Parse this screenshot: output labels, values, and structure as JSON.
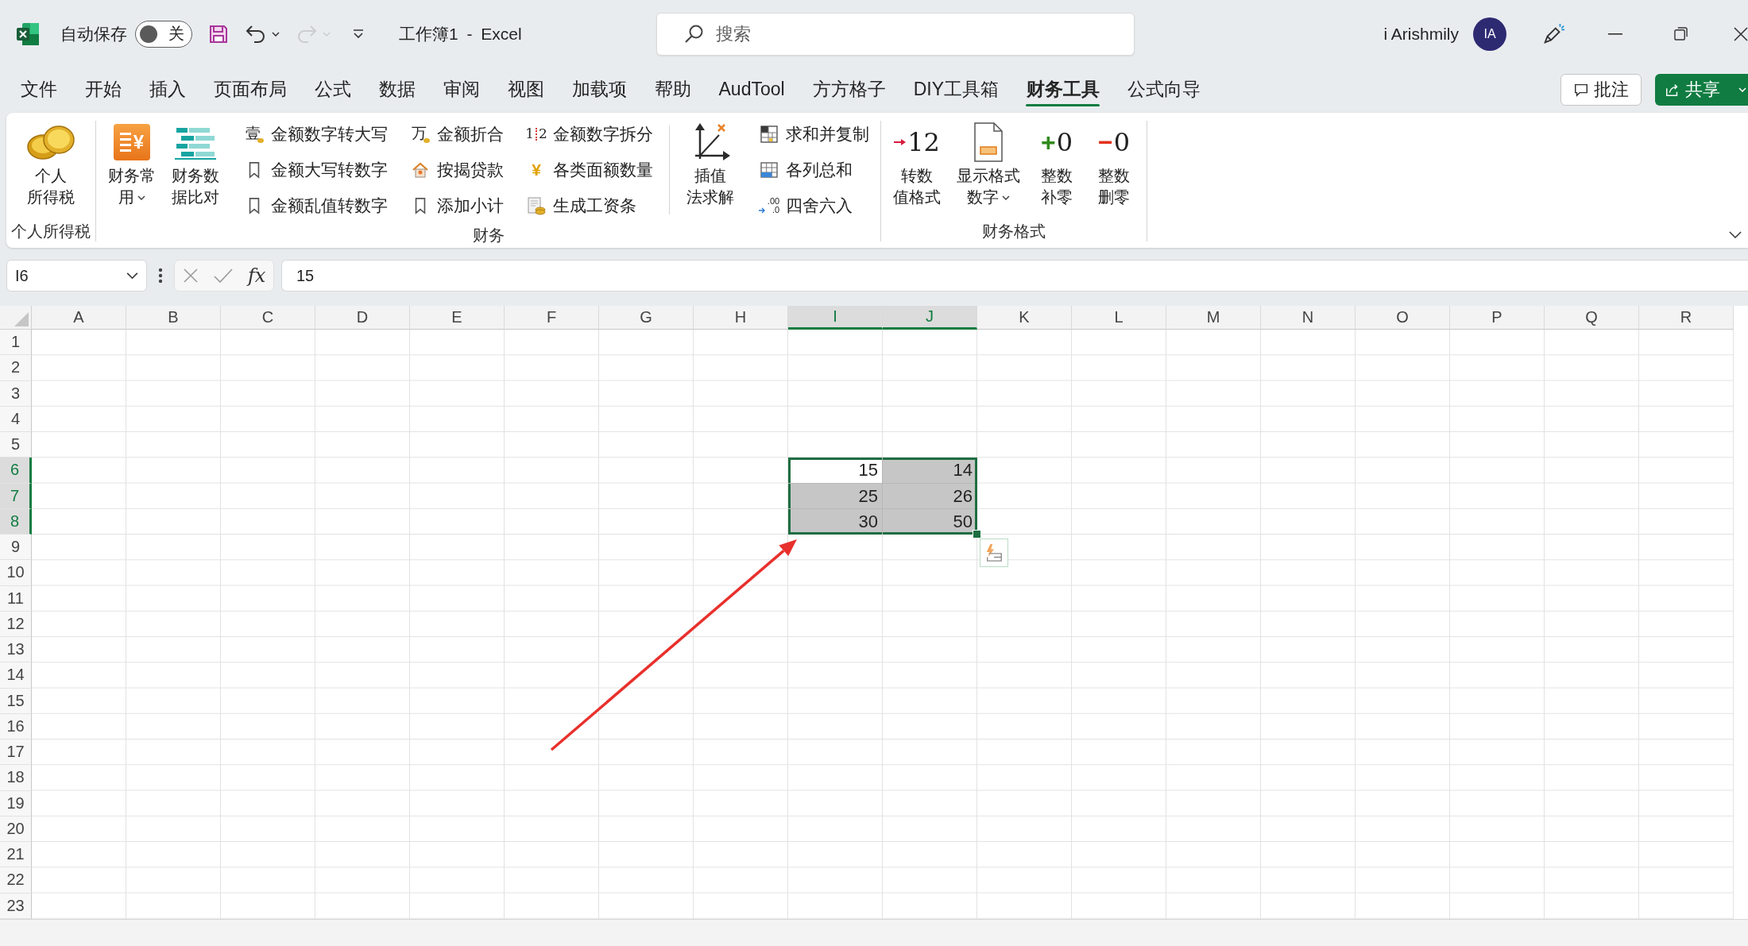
{
  "title_bar": {
    "autosave": {
      "label": "自动保存",
      "on": false,
      "state_text": "关"
    },
    "quick_access": [
      {
        "kind": "save",
        "disabled": false
      },
      {
        "kind": "undo",
        "disabled": false
      },
      {
        "kind": "redo",
        "disabled": true
      },
      {
        "kind": "customize",
        "disabled": false
      }
    ],
    "document_title": "工作簿1 - Excel",
    "search": {
      "placeholder": "搜索"
    },
    "user": {
      "name": "i Arishmily",
      "initials": "IA"
    }
  },
  "menu_tabs": [
    {
      "label": "文件",
      "selected": false
    },
    {
      "label": "开始",
      "selected": false
    },
    {
      "label": "插入",
      "selected": false
    },
    {
      "label": "页面布局",
      "selected": false
    },
    {
      "label": "公式",
      "selected": false
    },
    {
      "label": "数据",
      "selected": false
    },
    {
      "label": "审阅",
      "selected": false
    },
    {
      "label": "视图",
      "selected": false
    },
    {
      "label": "加载项",
      "selected": false
    },
    {
      "label": "帮助",
      "selected": false
    },
    {
      "label": "AudTool",
      "selected": false
    },
    {
      "label": "方方格子",
      "selected": false
    },
    {
      "label": "DIY工具箱",
      "selected": false
    },
    {
      "label": "财务工具",
      "selected": true
    },
    {
      "label": "公式向导",
      "selected": false
    }
  ],
  "ribbon_actions": [
    {
      "kind": "comment",
      "label": "批注"
    },
    {
      "kind": "share",
      "label": "共享"
    }
  ],
  "ribbon": {
    "groups": [
      {
        "label": "个人所得税",
        "sections": [
          [
            {
              "kind": "large",
              "lines": [
                "个人",
                "所得税"
              ],
              "dropdown": false
            }
          ]
        ]
      },
      {
        "label": "财务",
        "sections": [
          [
            {
              "kind": "large",
              "lines": [
                "财务常",
                "用"
              ],
              "glyph": [
                "¥"
              ],
              "dropdown": true
            },
            {
              "kind": "large",
              "lines": [
                "财务数",
                "据比对"
              ],
              "dropdown": false
            },
            {
              "kind": "column",
              "buttons": [
                {
                  "label": "金额数字转大写",
                  "glyph": [
                    "壹"
                  ]
                },
                {
                  "label": "金额大写转数字"
                },
                {
                  "label": "金额乱值转数字"
                }
              ]
            },
            {
              "kind": "column",
              "buttons": [
                {
                  "label": "金额折合",
                  "glyph": [
                    "万"
                  ]
                },
                {
                  "label": "按揭贷款"
                },
                {
                  "label": "添加小计"
                }
              ]
            },
            {
              "kind": "column",
              "buttons": [
                {
                  "label": "金额数字拆分",
                  "glyph": [
                    "1",
                    "2"
                  ]
                },
                {
                  "label": "各类面额数量",
                  "glyph": [
                    "¥"
                  ]
                },
                {
                  "label": "生成工资条"
                }
              ]
            }
          ],
          [
            {
              "kind": "large",
              "lines": [
                "插值",
                "法求解"
              ],
              "dropdown": false
            },
            {
              "kind": "column",
              "buttons": [
                {
                  "label": "求和并复制"
                },
                {
                  "label": "各列总和"
                },
                {
                  "label": "四舍六入",
                  "glyph": [
                    ".00",
                    ".0"
                  ]
                }
              ]
            }
          ]
        ]
      },
      {
        "label": "财务格式",
        "sections": [
          [
            {
              "kind": "large",
              "lines": [
                "转数",
                "值格式"
              ],
              "glyph": [
                "12"
              ],
              "dropdown": false
            },
            {
              "kind": "large",
              "lines": [
                "显示格式",
                "数字"
              ],
              "dropdown": true
            },
            {
              "kind": "large",
              "lines": [
                "整数",
                "补零"
              ],
              "sign": "+",
              "glyph": [
                "0"
              ],
              "dropdown": false
            },
            {
              "kind": "large",
              "lines": [
                "整数",
                "删零"
              ],
              "sign": "−",
              "glyph": [
                "0"
              ],
              "dropdown": false
            }
          ]
        ]
      }
    ]
  },
  "formula_bar": {
    "name_box": "I6",
    "function_label": "fx",
    "formula": "15"
  },
  "sheet": {
    "columns": [
      {
        "label": "A",
        "selected": false
      },
      {
        "label": "B",
        "selected": false
      },
      {
        "label": "C",
        "selected": false
      },
      {
        "label": "D",
        "selected": false
      },
      {
        "label": "E",
        "selected": false
      },
      {
        "label": "F",
        "selected": false
      },
      {
        "label": "G",
        "selected": false
      },
      {
        "label": "H",
        "selected": false
      },
      {
        "label": "I",
        "selected": true
      },
      {
        "label": "J",
        "selected": true
      },
      {
        "label": "K",
        "selected": false
      },
      {
        "label": "L",
        "selected": false
      },
      {
        "label": "M",
        "selected": false
      },
      {
        "label": "N",
        "selected": false
      },
      {
        "label": "O",
        "selected": false
      },
      {
        "label": "P",
        "selected": false
      },
      {
        "label": "Q",
        "selected": false
      },
      {
        "label": "R",
        "selected": false
      }
    ],
    "rows": [
      {
        "label": "1",
        "selected": false
      },
      {
        "label": "2",
        "selected": false
      },
      {
        "label": "3",
        "selected": false
      },
      {
        "label": "4",
        "selected": false
      },
      {
        "label": "5",
        "selected": false
      },
      {
        "label": "6",
        "selected": true,
        "cells": {
          "I": {
            "value": "15",
            "selected": true,
            "active": true
          },
          "J": {
            "value": "14",
            "selected": true,
            "active": false
          }
        }
      },
      {
        "label": "7",
        "selected": true,
        "cells": {
          "I": {
            "value": "25",
            "selected": true,
            "active": false
          },
          "J": {
            "value": "26",
            "selected": true,
            "active": false
          }
        }
      },
      {
        "label": "8",
        "selected": true,
        "cells": {
          "I": {
            "value": "30",
            "selected": true,
            "active": false
          },
          "J": {
            "value": "50",
            "selected": true,
            "active": false
          }
        }
      },
      {
        "label": "9",
        "selected": false
      },
      {
        "label": "10",
        "selected": false
      },
      {
        "label": "11",
        "selected": false
      },
      {
        "label": "12",
        "selected": false
      },
      {
        "label": "13",
        "selected": false
      },
      {
        "label": "14",
        "selected": false
      },
      {
        "label": "15",
        "selected": false
      },
      {
        "label": "16",
        "selected": false
      },
      {
        "label": "17",
        "selected": false
      },
      {
        "label": "18",
        "selected": false
      },
      {
        "label": "19",
        "selected": false
      },
      {
        "label": "20",
        "selected": false
      },
      {
        "label": "21",
        "selected": false
      },
      {
        "label": "22",
        "selected": false
      },
      {
        "label": "23",
        "selected": false
      }
    ]
  }
}
